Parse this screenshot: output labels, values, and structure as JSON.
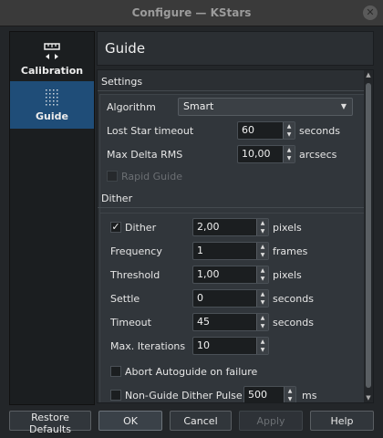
{
  "window": {
    "title": "Configure — KStars"
  },
  "sidebar": {
    "items": [
      {
        "label": "Calibration",
        "icon": "ruler-icon",
        "selected": false
      },
      {
        "label": "Guide",
        "icon": "guide-grid-icon",
        "selected": true
      }
    ]
  },
  "page": {
    "title": "Guide"
  },
  "settings": {
    "title": "Settings",
    "algorithm_label": "Algorithm",
    "algorithm_value": "Smart",
    "lost_star_label": "Lost Star timeout",
    "lost_star_value": "60",
    "lost_star_unit": "seconds",
    "max_delta_label": "Max Delta RMS",
    "max_delta_value": "10,00",
    "max_delta_unit": "arcsecs",
    "rapid_guide_label": "Rapid Guide"
  },
  "dither": {
    "title": "Dither",
    "dither_label": "Dither",
    "dither_value": "2,00",
    "dither_unit": "pixels",
    "frequency_label": "Frequency",
    "frequency_value": "1",
    "frequency_unit": "frames",
    "threshold_label": "Threshold",
    "threshold_value": "1,00",
    "threshold_unit": "pixels",
    "settle_label": "Settle",
    "settle_value": "0",
    "settle_unit": "seconds",
    "timeout_label": "Timeout",
    "timeout_value": "45",
    "timeout_unit": "seconds",
    "max_iter_label": "Max. Iterations",
    "max_iter_value": "10",
    "abort_label": "Abort Autoguide on failure",
    "nonguide_label": "Non-Guide Dither Pulse",
    "nonguide_value": "500",
    "nonguide_unit": "ms"
  },
  "buttons": {
    "restore": "Restore Defaults",
    "ok": "OK",
    "cancel": "Cancel",
    "apply": "Apply",
    "help": "Help"
  },
  "colors": {
    "selection": "#1f4d78",
    "background": "#232629"
  }
}
